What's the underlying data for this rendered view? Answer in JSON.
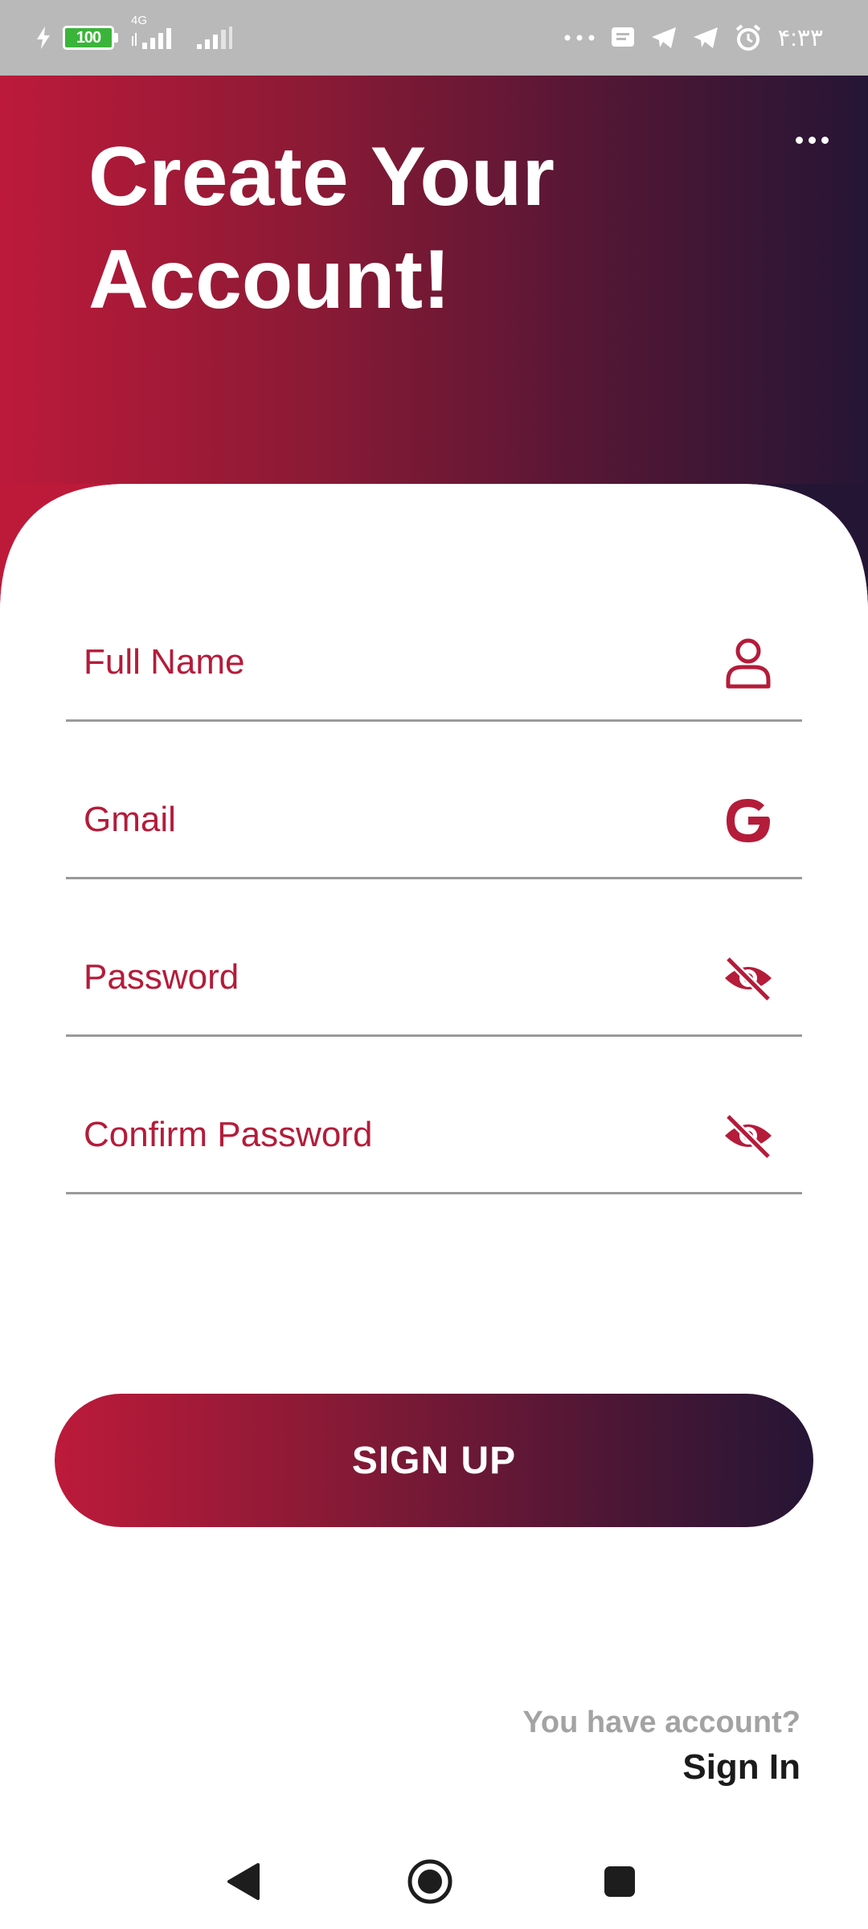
{
  "status_bar": {
    "battery_level": "100",
    "network_label": "4G",
    "clock": "۴:۳۳"
  },
  "header": {
    "title": "Create Your Account!",
    "menu_icon": "more-horiz-icon"
  },
  "form": {
    "full_name": {
      "placeholder": "Full Name",
      "icon": "person-icon"
    },
    "gmail": {
      "placeholder": "Gmail",
      "icon": "google-icon"
    },
    "password": {
      "placeholder": "Password",
      "icon": "eye-off-icon"
    },
    "confirm_password": {
      "placeholder": "Confirm Password",
      "icon": "eye-off-icon"
    }
  },
  "signup_button": {
    "label": "SIGN UP"
  },
  "footer": {
    "prompt": "You have account?",
    "sign_in_label": "Sign In"
  },
  "colors": {
    "accent": "#b41c3a",
    "gradient_start": "#bd1a3a",
    "gradient_end": "#251535",
    "status_bar_bg": "#b9b9b9"
  }
}
